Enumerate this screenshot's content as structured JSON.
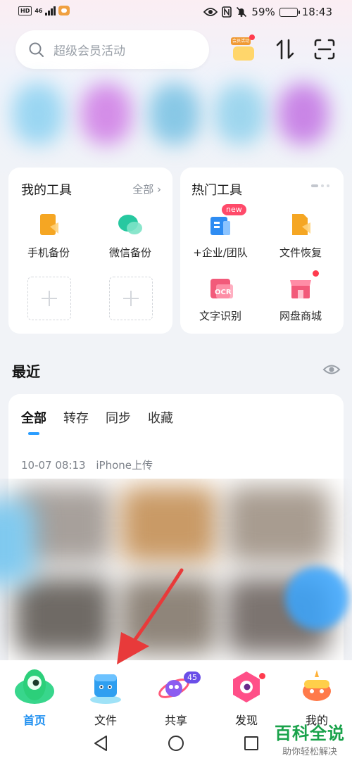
{
  "status_bar": {
    "network": "46",
    "battery": "59%",
    "battery_level": 0.59,
    "time": "18:43",
    "left_icons": [
      "hd-icon",
      "signal-icon",
      "message-icon"
    ],
    "right_icons": [
      "eye-icon",
      "nfc-icon",
      "mute-icon",
      "battery-icon"
    ]
  },
  "header": {
    "search_placeholder": "超级会员活动",
    "promo_badge": "会员活动"
  },
  "my_tools": {
    "title": "我的工具",
    "all_link": "全部",
    "items": [
      {
        "label": "手机备份",
        "icon": "phone-backup-icon"
      },
      {
        "label": "微信备份",
        "icon": "wechat-backup-icon"
      }
    ]
  },
  "hot_tools": {
    "title": "热门工具",
    "items": [
      {
        "label": "+企业/团队",
        "icon": "enterprise-icon",
        "badge": "new"
      },
      {
        "label": "文件恢复",
        "icon": "file-restore-icon"
      },
      {
        "label": "文字识别",
        "icon": "ocr-icon",
        "icon_text": "OCR"
      },
      {
        "label": "网盘商城",
        "icon": "store-icon"
      }
    ]
  },
  "recent": {
    "title": "最近",
    "tabs": [
      {
        "label": "全部",
        "active": true
      },
      {
        "label": "转存",
        "active": false
      },
      {
        "label": "同步",
        "active": false
      },
      {
        "label": "收藏",
        "active": false
      }
    ],
    "group": {
      "time": "10-07 08:13",
      "source": "iPhone上传"
    }
  },
  "bottom_nav": [
    {
      "label": "首页",
      "icon": "home-icon",
      "active": true
    },
    {
      "label": "文件",
      "icon": "file-icon",
      "active": false
    },
    {
      "label": "共享",
      "icon": "share-icon",
      "active": false,
      "badge": "45"
    },
    {
      "label": "发现",
      "icon": "discover-icon",
      "active": false
    },
    {
      "label": "我的",
      "icon": "profile-icon",
      "active": false
    }
  ],
  "watermark": {
    "title": "百科全说",
    "subtitle": "助你轻松解决"
  },
  "colors": {
    "accent": "#1e8ff0",
    "badge_red": "#ff3b4e",
    "watermark_green": "#19a24a",
    "annotation_red": "#e83a3a"
  }
}
